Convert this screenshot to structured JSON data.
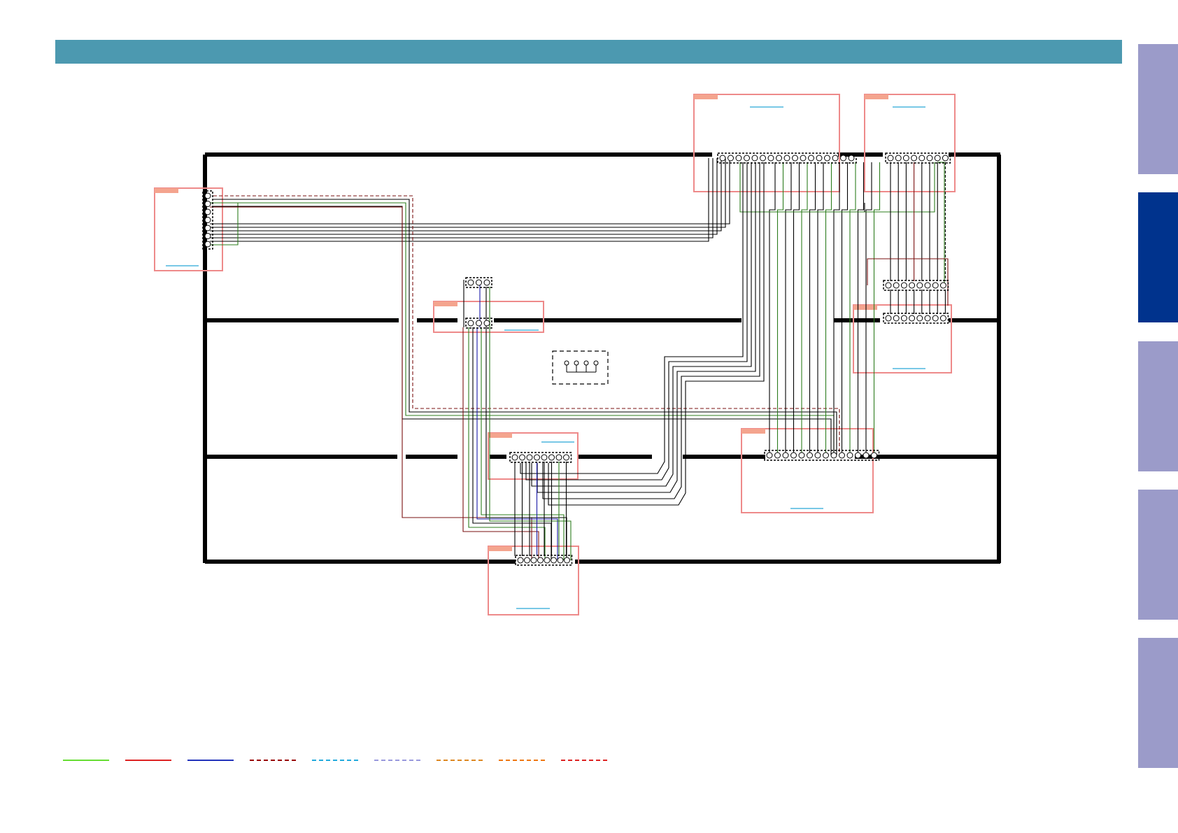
{
  "page": {
    "title": ""
  },
  "colors": {
    "header": "#4c99b0",
    "tab_inactive": "#9b9bc9",
    "tab_active": "#00338d",
    "frame": "#000000",
    "block_border": "#ee8a8a",
    "block_tag": "#f4a48e",
    "block_link": "#29a8d8",
    "wire_black": "#000000",
    "wire_green": "#2e7d1e",
    "wire_darkred": "#7a1010",
    "wire_blue": "#1a1aa8"
  },
  "side_tabs": [
    {
      "name": "tab-1",
      "active": false
    },
    {
      "name": "tab-2",
      "active": true
    },
    {
      "name": "tab-3",
      "active": false
    },
    {
      "name": "tab-4",
      "active": false
    },
    {
      "name": "tab-5",
      "active": false
    }
  ],
  "legend": [
    {
      "style": "solid",
      "color": "#66dd33"
    },
    {
      "style": "solid",
      "color": "#dd2222"
    },
    {
      "style": "solid",
      "color": "#2233bb"
    },
    {
      "style": "dashed",
      "color": "#990000"
    },
    {
      "style": "dashed",
      "color": "#22aadd"
    },
    {
      "style": "dashed",
      "color": "#9999dd"
    },
    {
      "style": "dashed",
      "color": "#dd8822"
    },
    {
      "style": "dashed",
      "color": "#ee7711"
    },
    {
      "style": "dashed",
      "color": "#dd2222"
    }
  ]
}
